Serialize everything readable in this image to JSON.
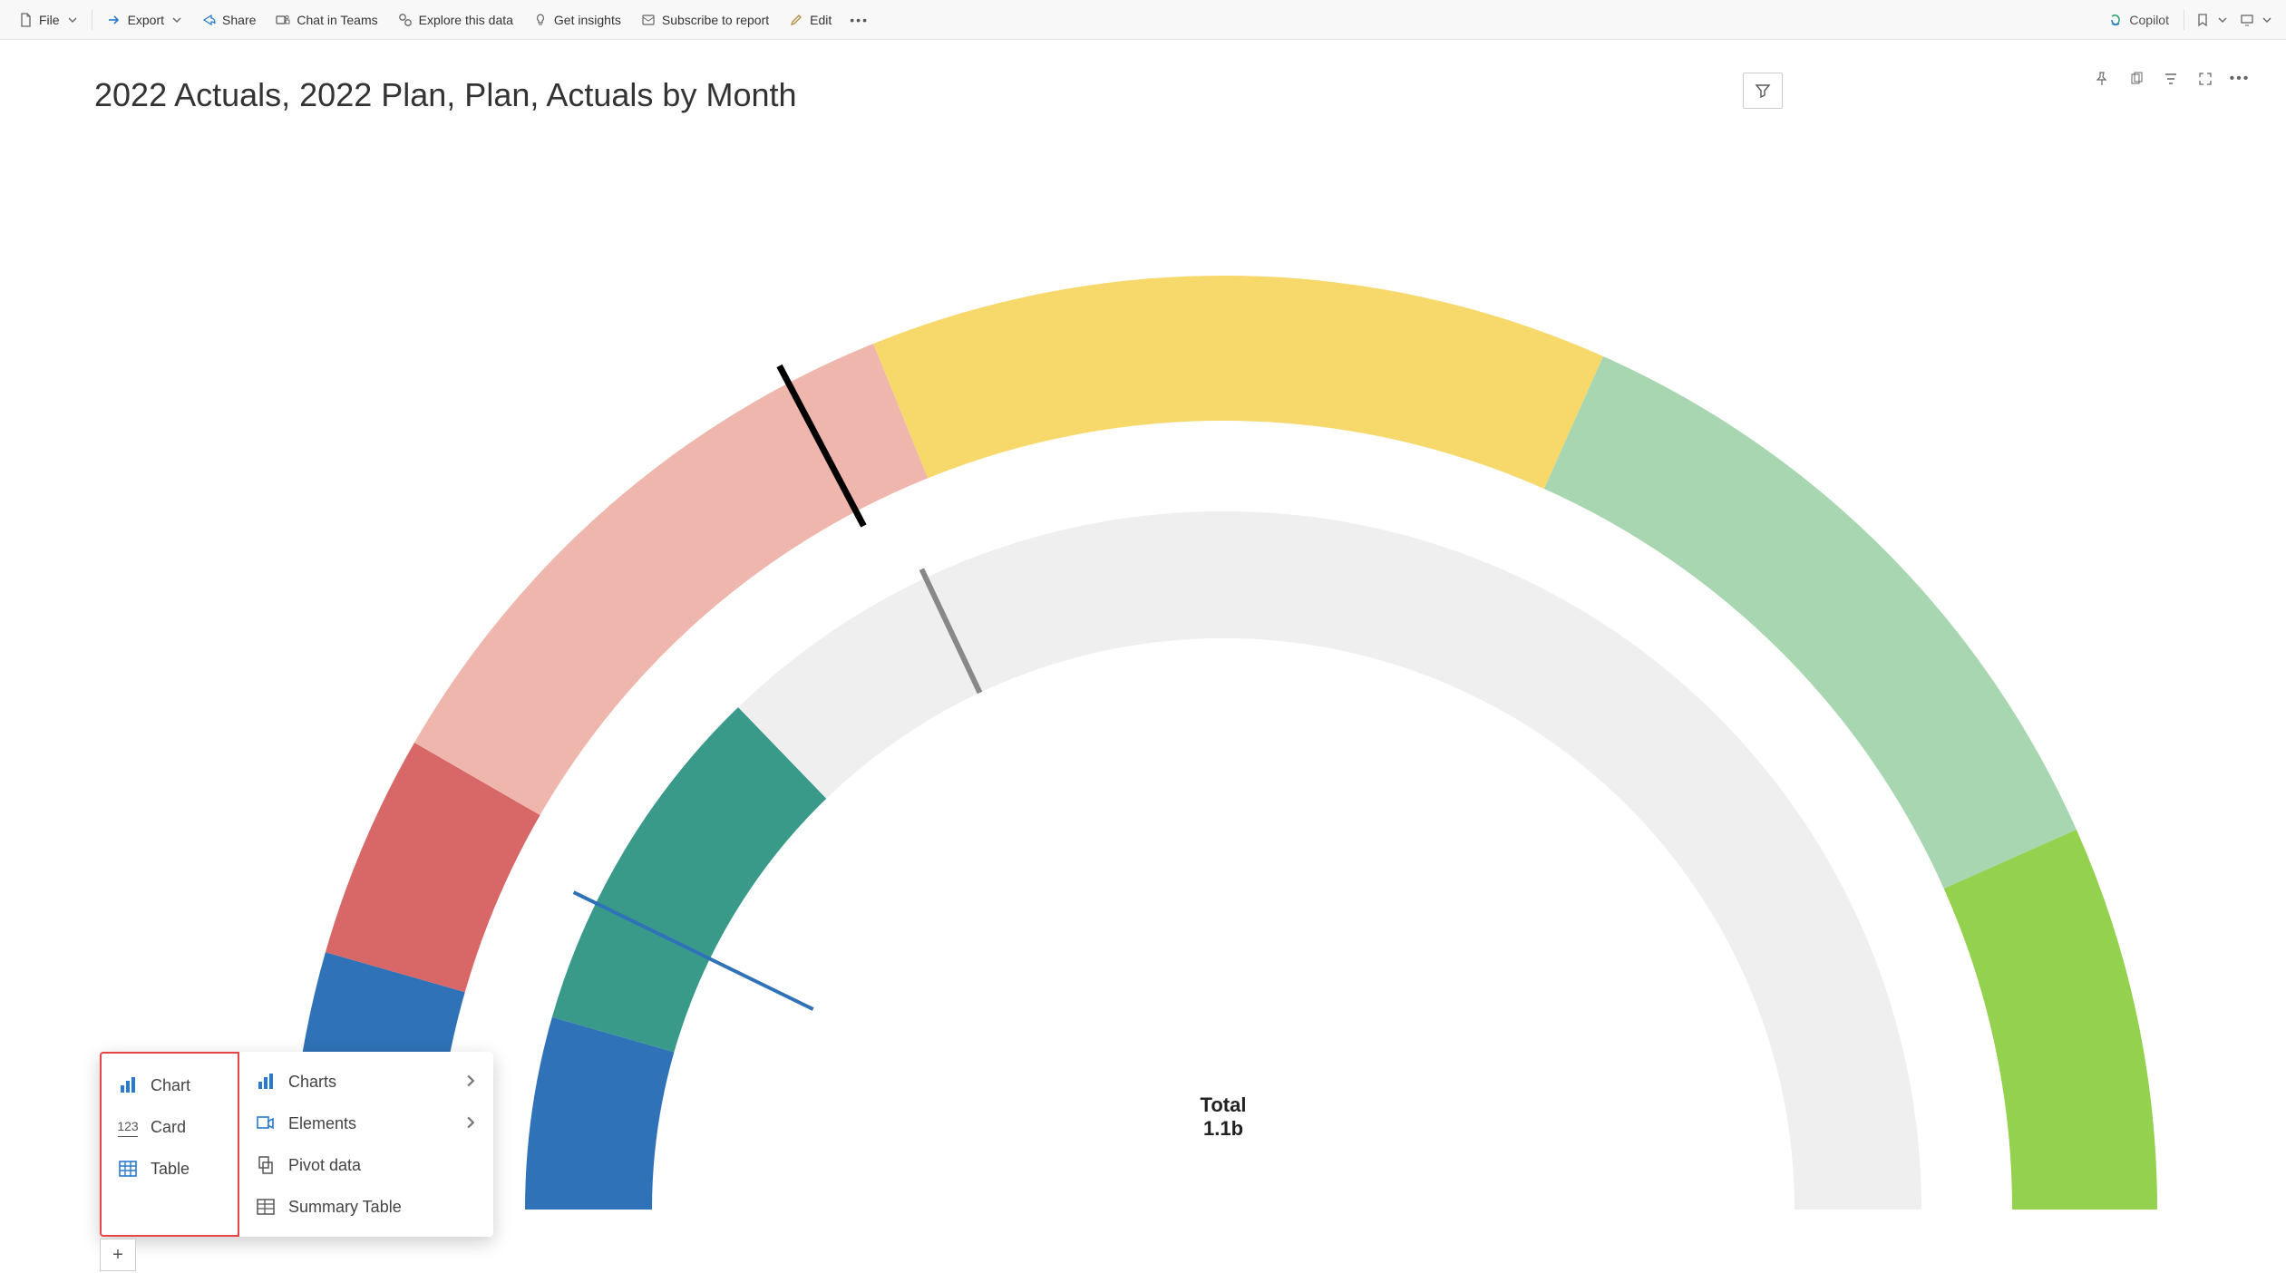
{
  "toolbar": {
    "file": "File",
    "export": "Export",
    "share": "Share",
    "chat_in_teams": "Chat in Teams",
    "explore": "Explore this data",
    "insights": "Get insights",
    "subscribe": "Subscribe to report",
    "edit": "Edit",
    "copilot": "Copilot"
  },
  "report": {
    "title": "2022 Actuals, 2022 Plan, Plan, Actuals by Month"
  },
  "gauge": {
    "total_label": "Total",
    "total_value": "1.1b"
  },
  "add_menu": {
    "left": {
      "chart": "Chart",
      "card": "Card",
      "table": "Table"
    },
    "right": {
      "charts": "Charts",
      "elements": "Elements",
      "pivot": "Pivot data",
      "summary": "Summary Table"
    }
  },
  "chart_data": {
    "type": "pie",
    "title": "2022 Actuals, 2022 Plan, Plan, Actuals by Month",
    "total_label": "Total",
    "total_value": "1.1b",
    "rings": [
      {
        "name": "outer",
        "segments": [
          {
            "color": "#2f72b7",
            "angle_deg": 16
          },
          {
            "color": "#d86868",
            "angle_deg": 14
          },
          {
            "color": "#efb6ad",
            "angle_deg": 38
          },
          {
            "color": "#f7d86b",
            "angle_deg": 46
          },
          {
            "color": "#a7d6b0",
            "angle_deg": 42
          },
          {
            "color": "#94d14f",
            "angle_deg": 44
          }
        ]
      },
      {
        "name": "inner",
        "segments": [
          {
            "color": "#2f72b7",
            "angle_deg": 16
          },
          {
            "color": "#3a9a8a",
            "angle_deg": 30
          },
          {
            "color": "#efefef",
            "angle_deg": 154
          }
        ]
      }
    ],
    "needles": [
      {
        "ring": "outer",
        "angle_from_left_deg": 62,
        "color": "#000"
      },
      {
        "ring": "inner",
        "angle_from_left_deg": 64,
        "color": "#888"
      },
      {
        "ring": "inner",
        "angle_from_left_deg": 34,
        "color": "#2f72b7"
      }
    ]
  }
}
